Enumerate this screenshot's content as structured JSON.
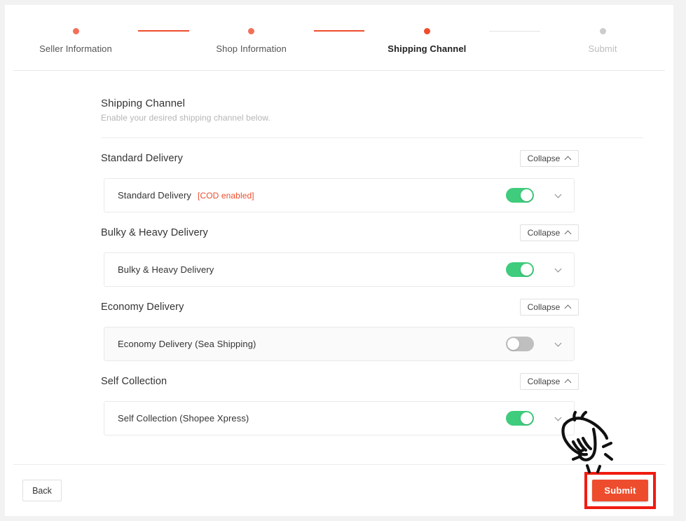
{
  "stepper": {
    "steps": [
      {
        "label": "Seller Information",
        "state": "done"
      },
      {
        "label": "Shop Information",
        "state": "done"
      },
      {
        "label": "Shipping Channel",
        "state": "current"
      },
      {
        "label": "Submit",
        "state": "todo"
      }
    ]
  },
  "header": {
    "title": "Shipping Channel",
    "subtitle": "Enable your desired shipping channel below."
  },
  "groups": [
    {
      "name": "Standard Delivery",
      "collapse_label": "Collapse",
      "rows": [
        {
          "label": "Standard Delivery",
          "tag": "[COD enabled]",
          "toggle": "on"
        }
      ]
    },
    {
      "name": "Bulky & Heavy Delivery",
      "collapse_label": "Collapse",
      "rows": [
        {
          "label": "Bulky & Heavy Delivery",
          "tag": "",
          "toggle": "on"
        }
      ]
    },
    {
      "name": "Economy Delivery",
      "collapse_label": "Collapse",
      "rows": [
        {
          "label": "Economy Delivery (Sea Shipping)",
          "tag": "",
          "toggle": "off"
        }
      ]
    },
    {
      "name": "Self Collection",
      "collapse_label": "Collapse",
      "rows": [
        {
          "label": "Self Collection (Shopee Xpress)",
          "tag": "",
          "toggle": "on"
        }
      ]
    }
  ],
  "footer": {
    "back_label": "Back",
    "submit_label": "Submit"
  },
  "colors": {
    "accent": "#ee4d2d",
    "step_done": "#f2705a",
    "step_todo": "#cccccc",
    "toggle_on": "#3fcc7c",
    "toggle_off": "#bfbfbf",
    "highlight": "#f01c10",
    "page_background": "#f2f2f2"
  },
  "icons": {
    "collapse_chevron": "chevron-up-icon",
    "row_chevron": "chevron-down-icon",
    "cursor": "hand-pointer-icon"
  }
}
